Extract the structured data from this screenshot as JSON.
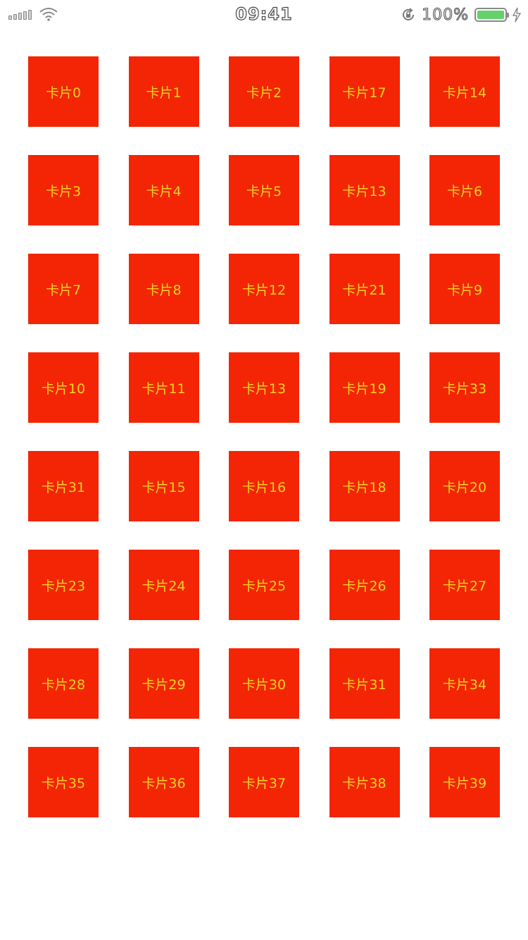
{
  "status_bar": {
    "time": "09:41",
    "battery_percent": "100%",
    "battery_level": 1.0,
    "battery_color": "#65d16b",
    "icons": [
      "signal-icon",
      "wifi-icon",
      "rotation-lock-icon",
      "battery-icon",
      "charging-icon"
    ]
  },
  "colors": {
    "card_background": "#f32504",
    "card_text": "#f3d41e"
  },
  "cards": [
    "卡片0",
    "卡片1",
    "卡片2",
    "卡片17",
    "卡片14",
    "卡片3",
    "卡片4",
    "卡片5",
    "卡片13",
    "卡片6",
    "卡片7",
    "卡片8",
    "卡片12",
    "卡片21",
    "卡片9",
    "卡片10",
    "卡片11",
    "卡片13",
    "卡片19",
    "卡片33",
    "卡片31",
    "卡片15",
    "卡片16",
    "卡片18",
    "卡片20",
    "卡片23",
    "卡片24",
    "卡片25",
    "卡片26",
    "卡片27",
    "卡片28",
    "卡片29",
    "卡片30",
    "卡片31",
    "卡片34",
    "卡片35",
    "卡片36",
    "卡片37",
    "卡片38",
    "卡片39"
  ]
}
